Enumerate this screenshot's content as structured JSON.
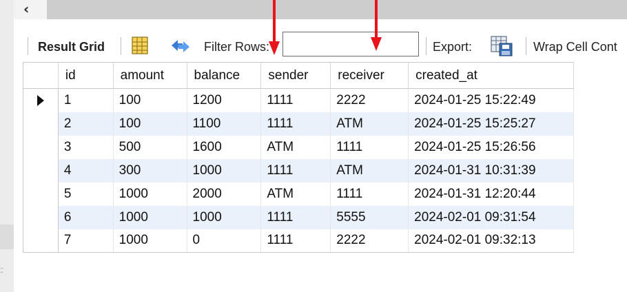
{
  "toolbar": {
    "result_grid_label": "Result Grid",
    "filter_rows_label": "Filter Rows:",
    "filter_value": "",
    "export_label": "Export:",
    "wrap_label": "Wrap Cell Cont"
  },
  "grid": {
    "columns": [
      "id",
      "amount",
      "balance",
      "sender",
      "receiver",
      "created_at"
    ],
    "rows": [
      [
        "1",
        "100",
        "1200",
        "1111",
        "2222",
        "2024-01-25 15:22:49"
      ],
      [
        "2",
        "100",
        "1100",
        "1111",
        "ATM",
        "2024-01-25 15:25:27"
      ],
      [
        "3",
        "500",
        "1600",
        "ATM",
        "1111",
        "2024-01-25 15:26:56"
      ],
      [
        "4",
        "300",
        "1000",
        "1111",
        "ATM",
        "2024-01-31 10:31:39"
      ],
      [
        "5",
        "1000",
        "2000",
        "ATM",
        "1111",
        "2024-01-31 12:20:44"
      ],
      [
        "6",
        "1000",
        "1000",
        "1111",
        "5555",
        "2024-02-01 09:31:54"
      ],
      [
        "7",
        "1000",
        "0",
        "1111",
        "2222",
        "2024-02-01 09:32:13"
      ]
    ],
    "selected_row": 0
  },
  "colors": {
    "alt_row": "#eaf1fb",
    "annotation_arrow": "#e8141b",
    "tab_bar": "#cdcdcd"
  },
  "icons": {
    "scroll_left": "chevron-left-icon",
    "result_grid": "grid-icon",
    "refresh": "refresh-icon",
    "export": "export-icon",
    "row_marker": "current-row-icon"
  }
}
